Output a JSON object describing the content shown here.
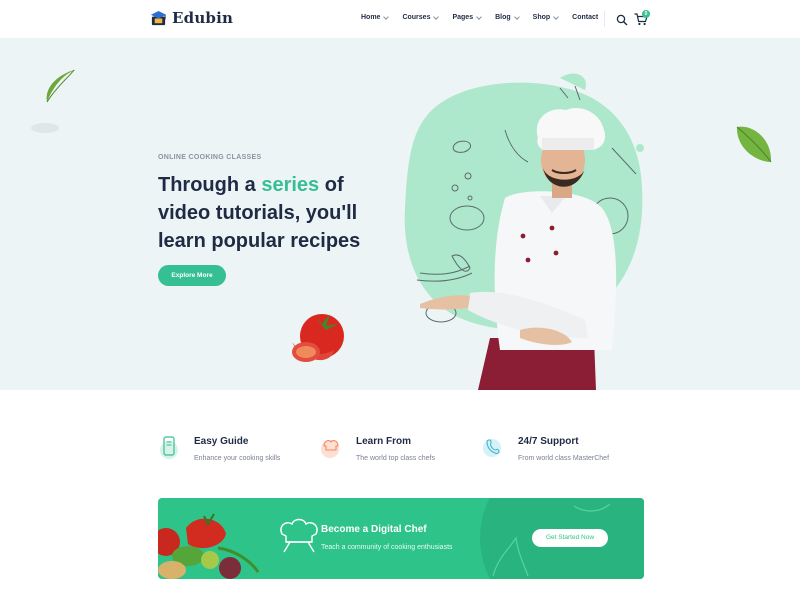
{
  "brand": {
    "name": "Edubin"
  },
  "nav": {
    "items": [
      {
        "label": "Home"
      },
      {
        "label": "Courses"
      },
      {
        "label": "Pages"
      },
      {
        "label": "Blog"
      },
      {
        "label": "Shop"
      },
      {
        "label": "Contact"
      }
    ],
    "cart_count": "0"
  },
  "hero": {
    "eyebrow": "ONLINE COOKING CLASSES",
    "title_part1": "Through a ",
    "title_accent": "series",
    "title_part2": " of video tutorials, you'll learn popular recipes",
    "cta_label": "Explore More"
  },
  "features": [
    {
      "title": "Easy Guide",
      "subtitle": "Enhance your cooking skills",
      "icon": "phone-guide-icon"
    },
    {
      "title": "Learn From",
      "subtitle": "The world top class chefs",
      "icon": "chef-hat-icon"
    },
    {
      "title": "24/7 Support",
      "subtitle": "From world class MasterChef",
      "icon": "support-phone-icon"
    }
  ],
  "banner": {
    "title": "Become a Digital Chef",
    "subtitle": "Teach a community of cooking enthusiasts",
    "button_label": "Get Started Now"
  },
  "colors": {
    "accent": "#36bf92",
    "heading": "#1f2a44",
    "hero_bg": "#edf4f5",
    "banner_bg": "#2ec389"
  }
}
